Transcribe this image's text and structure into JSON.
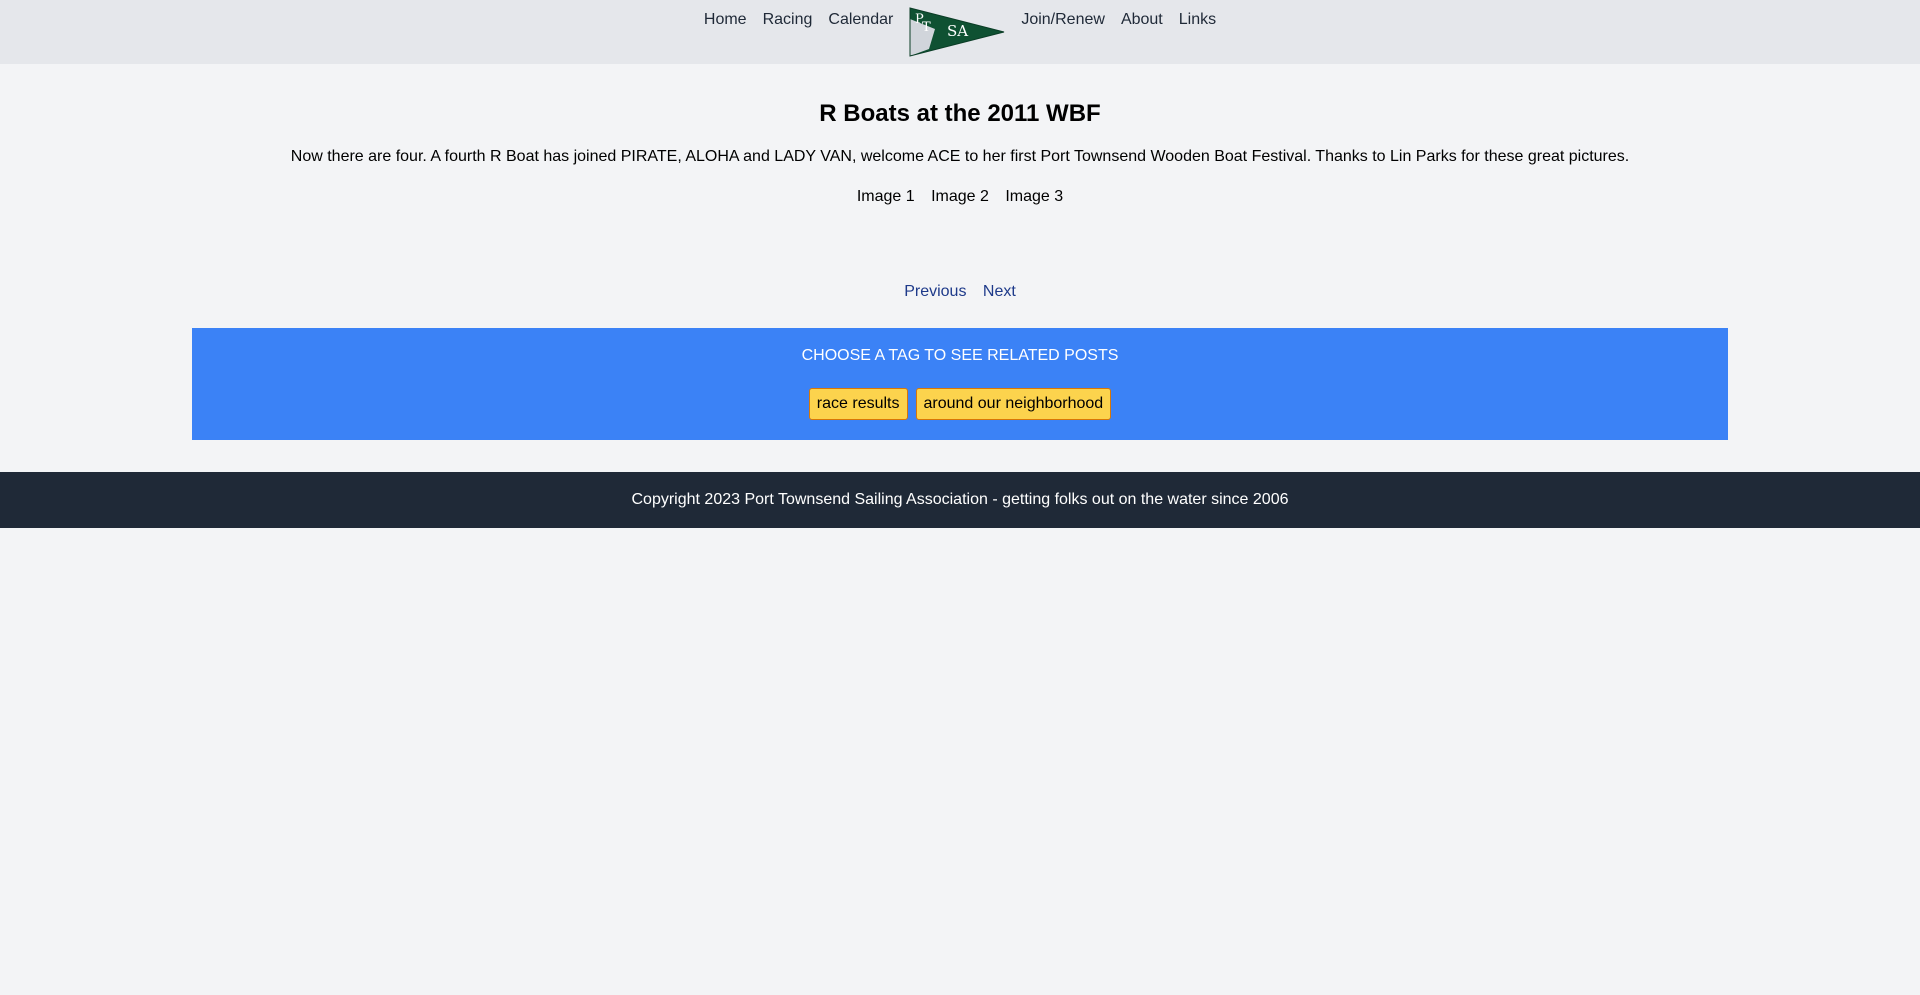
{
  "nav": {
    "left": [
      "Home",
      "Racing",
      "Calendar"
    ],
    "right": [
      "Join/Renew",
      "About",
      "Links"
    ],
    "logo_text": [
      "P",
      "T",
      "SA"
    ]
  },
  "post": {
    "title": "R Boats at the 2011 WBF",
    "body": "Now there are four. A fourth R Boat has joined PIRATE, ALOHA and LADY VAN, welcome ACE to her first Port Townsend Wooden Boat Festival. Thanks to Lin Parks for these great pictures.",
    "images": [
      "Image 1",
      "Image 2",
      "Image 3"
    ]
  },
  "pager": {
    "previous": "Previous",
    "next": "Next"
  },
  "tags": {
    "heading": "CHOOSE A TAG TO SEE RELATED POSTS",
    "items": [
      "race results",
      "around our neighborhood"
    ]
  },
  "footer": {
    "text": "Copyright 2023 Port Townsend Sailing Association - getting folks out on the water since 2006"
  },
  "colors": {
    "nav_bg": "#e5e7eb",
    "page_bg": "#f3f4f6",
    "tags_bg": "#3b82f6",
    "tag_bg": "#fcd34d",
    "footer_bg": "#1f2937",
    "link": "#1e3a8a",
    "logo_green": "#0f5132"
  }
}
